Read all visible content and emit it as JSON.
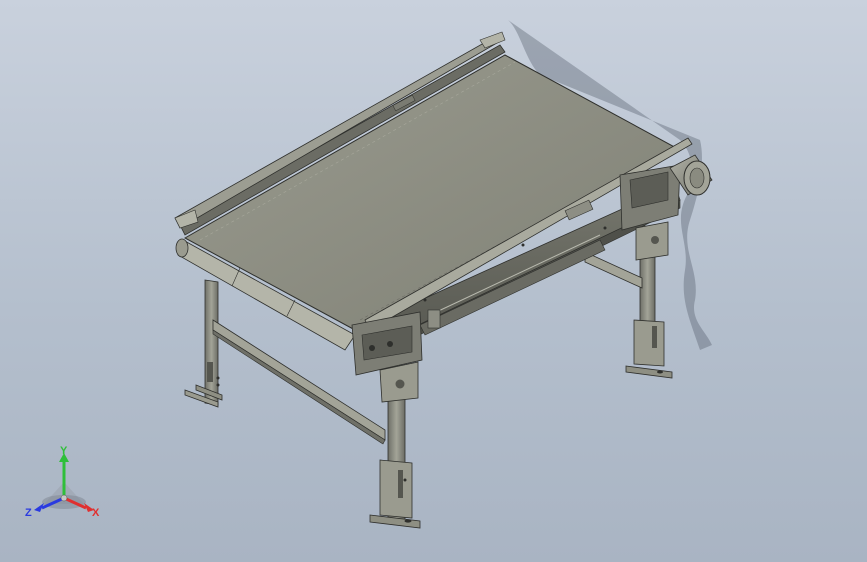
{
  "viewport": {
    "background_top": "#c9d1dd",
    "background_bottom": "#a9b4c3",
    "model": "belt-conveyor-assembly"
  },
  "triad": {
    "y_label": "Y",
    "x_label": "X",
    "z_label": "Z",
    "y_color": "#2fbf3a",
    "x_color": "#e03030",
    "z_color": "#2a3ae0"
  },
  "colors": {
    "belt": "#8a8b7e",
    "frame": "#8e8f83",
    "frame_dark": "#5e5f57",
    "edge": "#2e2f2c"
  }
}
